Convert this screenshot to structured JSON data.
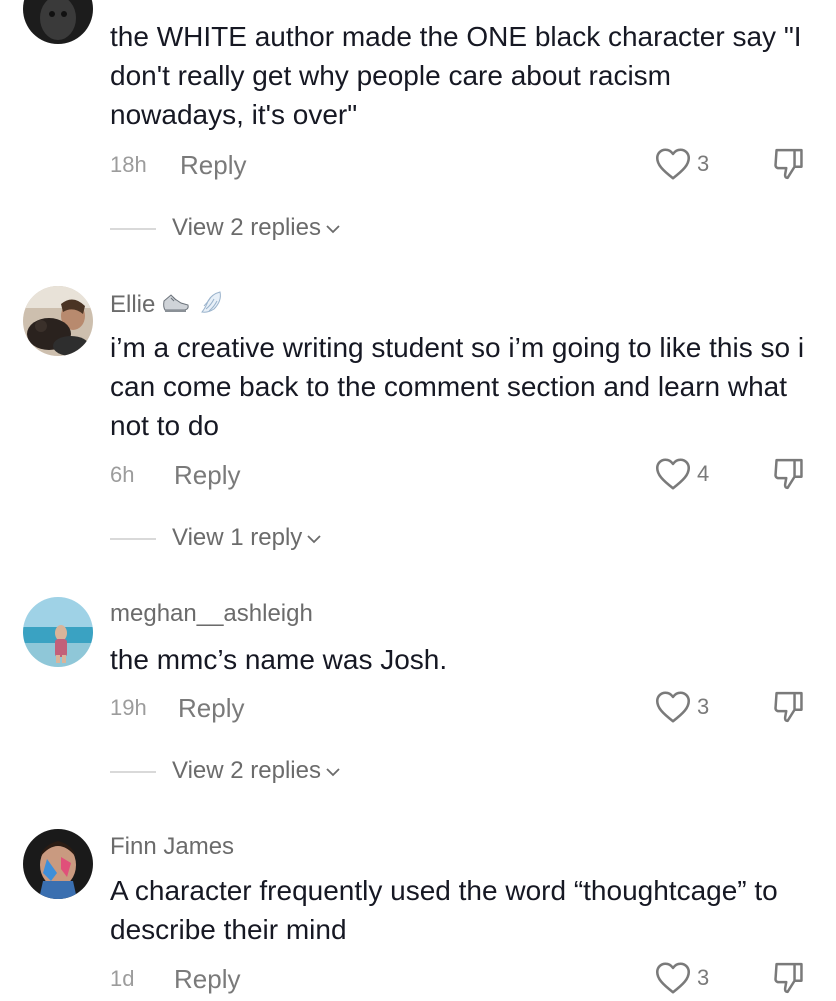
{
  "comments": [
    {
      "username": "",
      "text": "the WHITE author made the ONE black character say \"I don't really get why people care about racism nowadays, it's over\"",
      "time": "18h",
      "reply_label": "Reply",
      "likes": "3",
      "view_replies": "View 2 replies",
      "avatar_icon": "dark-profile-photo"
    },
    {
      "username": "Ellie",
      "badges": [
        "sneaker-emoji-icon",
        "wing-emoji-icon"
      ],
      "text": "i’m a creative writing student so i’m going to like this so i can come back to the comment section and learn what not to do",
      "time": "6h",
      "reply_label": "Reply",
      "likes": "4",
      "view_replies": "View 1 reply",
      "avatar_icon": "person-with-pet-photo"
    },
    {
      "username": "meghan__ashleigh",
      "text": "the mmc’s name was Josh.",
      "time": "19h",
      "reply_label": "Reply",
      "likes": "3",
      "view_replies": "View 2 replies",
      "avatar_icon": "beach-photo"
    },
    {
      "username": "Finn James",
      "text": "A character frequently used the word “thoughtcage” to describe their mind",
      "time": "1d",
      "reply_label": "Reply",
      "likes": "3",
      "avatar_icon": "painted-face-photo"
    }
  ],
  "colors": {
    "text_primary": "#161823",
    "text_secondary": "#6b6b6b",
    "text_muted": "#9c9c9c",
    "divider": "#d9d9d9"
  }
}
